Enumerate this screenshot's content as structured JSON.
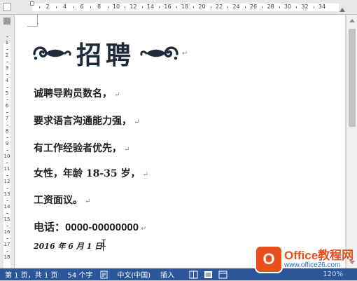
{
  "ruler": {
    "top_numbers": [
      "2",
      "4",
      "6",
      "8",
      "10",
      "12",
      "14",
      "16",
      "18",
      "20",
      "22",
      "24",
      "26",
      "28",
      "30",
      "32",
      "34"
    ],
    "left_numbers": [
      "1",
      "2",
      "3",
      "4",
      "5",
      "6",
      "7",
      "8",
      "9",
      "10",
      "11",
      "12",
      "13",
      "14",
      "15",
      "16",
      "17",
      "18"
    ]
  },
  "document": {
    "title": "招聘",
    "paragraphs": [
      "诚聘导购员数名，",
      "要求语言沟通能力强，",
      "有工作经验者优先，",
      "女性，年龄 18-35 岁，",
      "工资面议。"
    ],
    "phone_label": "电话：",
    "phone_number": "0000-00000000",
    "date": "2016 年 6 月 1 日",
    "pilcrow": "↵"
  },
  "status": {
    "page": "第 1 页，共 1 页",
    "words": "54 个字",
    "language": "中文(中国)",
    "mode": "插入",
    "zoom": "120%"
  },
  "watermark": {
    "logo_letter": "O",
    "title": "Office教程网",
    "url": "www.office26.com"
  },
  "colors": {
    "status_bar": "#2b579a",
    "title_text": "#1c2a3a",
    "watermark_accent": "#e94e1b"
  }
}
